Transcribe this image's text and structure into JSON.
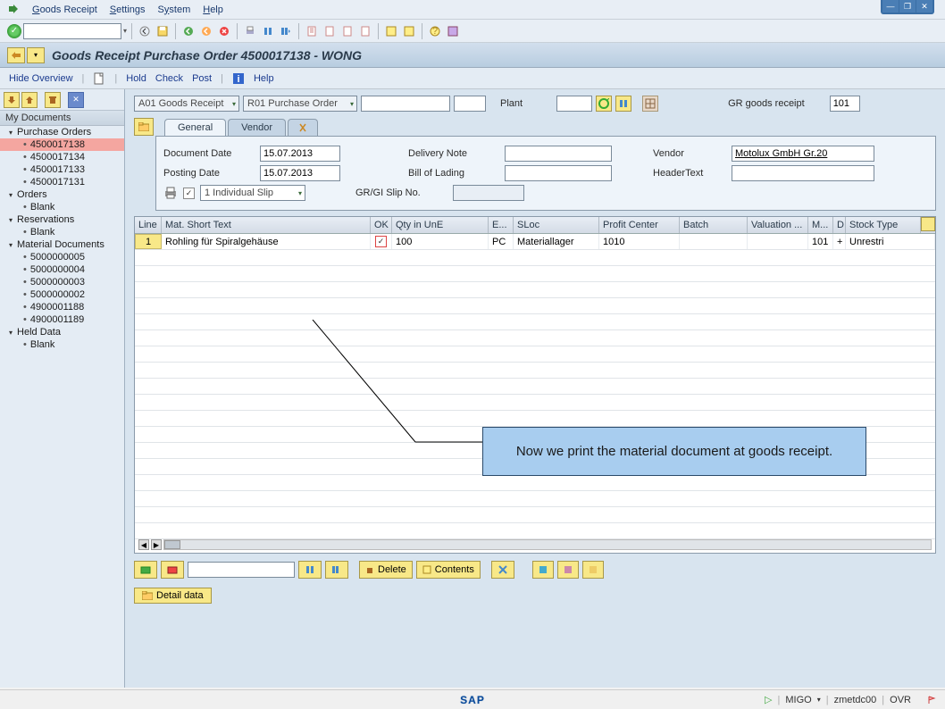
{
  "menubar": {
    "items": [
      "Goods Receipt",
      "Settings",
      "System",
      "Help"
    ]
  },
  "title": "Goods Receipt Purchase Order 4500017138 - WONG",
  "actionbar": {
    "hide_overview": "Hide Overview",
    "hold": "Hold",
    "check": "Check",
    "post": "Post",
    "help": "Help"
  },
  "sidebar": {
    "header": "My Documents",
    "sections": [
      {
        "label": "Purchase Orders",
        "items": [
          "4500017138",
          "4500017134",
          "4500017133",
          "4500017131"
        ],
        "selected": 0
      },
      {
        "label": "Orders",
        "items": [
          "Blank"
        ]
      },
      {
        "label": "Reservations",
        "items": [
          "Blank"
        ]
      },
      {
        "label": "Material Documents",
        "items": [
          "5000000005",
          "5000000004",
          "5000000003",
          "5000000002",
          "4900001188",
          "4900001189"
        ]
      },
      {
        "label": "Held Data",
        "items": [
          "Blank"
        ]
      }
    ]
  },
  "filters": {
    "action": "A01 Goods Receipt",
    "ref": "R01 Purchase Order",
    "doc_no": "",
    "item_no": "",
    "plant_label": "Plant",
    "plant_value": "",
    "gr_label": "GR goods receipt",
    "gr_code": "101"
  },
  "tabs": {
    "general": "General",
    "vendor": "Vendor"
  },
  "form": {
    "doc_date_label": "Document Date",
    "doc_date": "15.07.2013",
    "post_date_label": "Posting Date",
    "post_date": "15.07.2013",
    "deliv_note_label": "Delivery Note",
    "deliv_note": "",
    "bol_label": "Bill of Lading",
    "bol": "",
    "slip_label": "GR/GI Slip No.",
    "slip": "",
    "vendor_label": "Vendor",
    "vendor": "Motolux GmbH Gr.20",
    "header_label": "HeaderText",
    "header": "",
    "slip_type": "1 Individual Slip"
  },
  "grid": {
    "cols": [
      "Line",
      "Mat. Short Text",
      "OK",
      "Qty in UnE",
      "E...",
      "SLoc",
      "Profit Center",
      "Batch",
      "Valuation ...",
      "M...",
      "D",
      "Stock Type"
    ],
    "row": {
      "line": "1",
      "text": "Rohling für Spiralgehäuse",
      "ok": "✓",
      "qty": "100",
      "unit": "PC",
      "sloc": "Materiallager",
      "pc": "1010",
      "batch": "",
      "val": "",
      "m": "101",
      "d": "+",
      "stock": "Unrestri"
    }
  },
  "bottom": {
    "delete": "Delete",
    "contents": "Contents",
    "detail": "Detail data"
  },
  "callout": "Now we print the material document at goods receipt.",
  "status": {
    "tcode": "MIGO",
    "sys": "zmetdc00",
    "mode": "OVR"
  }
}
